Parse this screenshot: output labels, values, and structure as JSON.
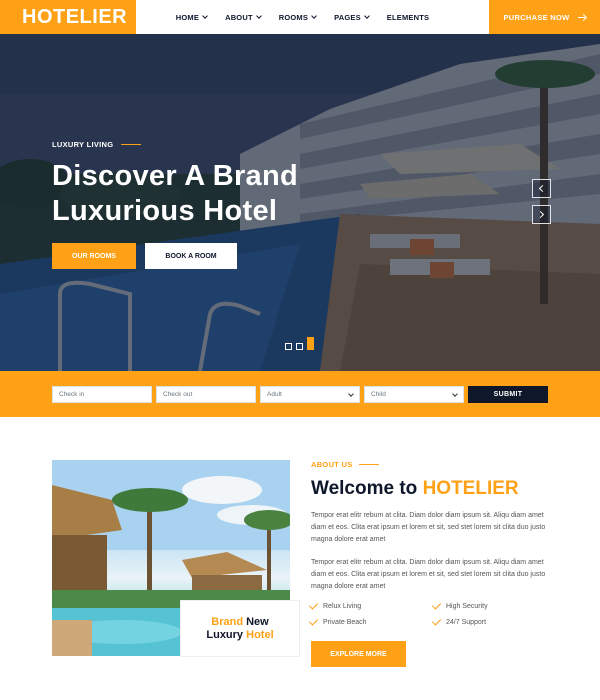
{
  "brand": {
    "name": "HOTELIER"
  },
  "nav": {
    "items": [
      {
        "label": "HOME",
        "dropdown": true
      },
      {
        "label": "ABOUT",
        "dropdown": true
      },
      {
        "label": "ROOMS",
        "dropdown": true
      },
      {
        "label": "PAGES",
        "dropdown": true
      },
      {
        "label": "ELEMENTS",
        "dropdown": false
      }
    ],
    "purchase_label": "PURCHASE NOW"
  },
  "hero": {
    "eyebrow": "LUXURY LIVING",
    "title_line1": "Discover A Brand",
    "title_line2": "Luxurious Hotel",
    "btn_primary": "OUR ROOMS",
    "btn_secondary": "BOOK A ROOM",
    "slides": 3,
    "active_slide": 3
  },
  "booking": {
    "checkin_placeholder": "Check in",
    "checkout_placeholder": "Check out",
    "adult_label": "Adult",
    "child_label": "Child",
    "submit_label": "SUBMIT"
  },
  "about": {
    "eyebrow": "ABOUT US",
    "title_prefix": "Welcome to ",
    "title_brand": "HOTELIER",
    "paragraph1": "Tempor erat elitr rebum at clita. Diam dolor diam ipsum sit. Aliqu diam amet diam et eos. Clita erat ipsum et lorem et sit, sed stet lorem sit clita duo justo magna dolore erat amet",
    "paragraph2": "Tempor erat elitr rebum at clita. Diam dolor diam ipsum sit. Aliqu diam amet diam et eos. Clita erat ipsum et lorem et sit, sed stet lorem sit clita duo justo magna dolore erat amet",
    "features": [
      "Relux Living",
      "High Security",
      "Private Beach",
      "24/7 Support"
    ],
    "explore_label": "EXPLORE MORE",
    "badge_line1_a": "Brand",
    "badge_line1_b": " New",
    "badge_line2_a": "Luxury",
    "badge_line2_b": " Hotel"
  },
  "colors": {
    "accent": "#FEA116",
    "dark": "#0F172B"
  },
  "icons": {
    "nav_dropdown": "chevron-down-icon",
    "purchase": "arrow-right-icon",
    "carousel_prev": "chevron-left-icon",
    "carousel_next": "chevron-right-icon",
    "feature": "check-icon"
  }
}
